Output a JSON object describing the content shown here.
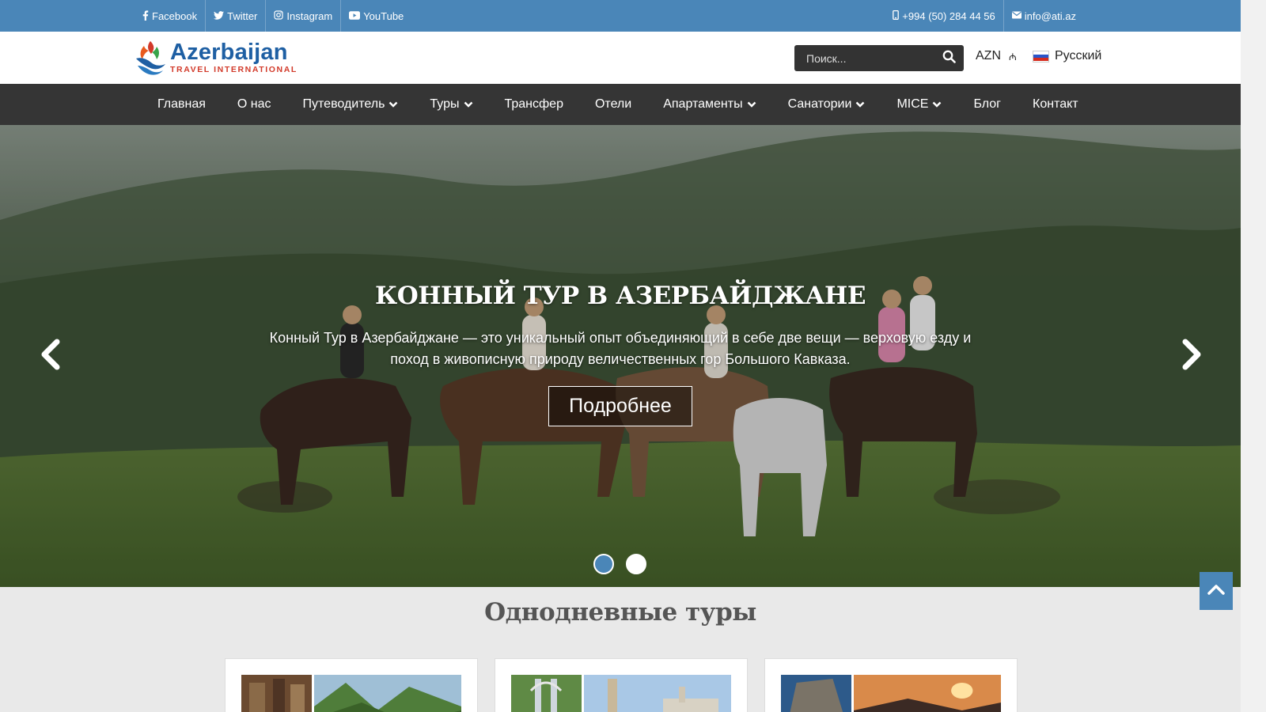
{
  "topbar": {
    "social": [
      {
        "label": "Facebook",
        "icon": "facebook-icon"
      },
      {
        "label": "Twitter",
        "icon": "twitter-icon"
      },
      {
        "label": "Instagram",
        "icon": "instagram-icon"
      },
      {
        "label": "YouTube",
        "icon": "youtube-icon"
      }
    ],
    "phone": "+994 (50) 284 44 56",
    "email": "info@ati.az"
  },
  "header": {
    "logo_title": "Azerbaijan",
    "logo_subtitle": "TRAVEL INTERNATIONAL",
    "search_placeholder": "Поиск...",
    "currency": "AZN",
    "currency_symbol": "₼",
    "language": "Русский"
  },
  "nav": {
    "items": [
      {
        "label": "Главная",
        "dropdown": false
      },
      {
        "label": "О нас",
        "dropdown": false
      },
      {
        "label": "Путеводитель",
        "dropdown": true
      },
      {
        "label": "Туры",
        "dropdown": true
      },
      {
        "label": "Трансфер",
        "dropdown": false
      },
      {
        "label": "Отели",
        "dropdown": false
      },
      {
        "label": "Апартаменты",
        "dropdown": true
      },
      {
        "label": "Санатории",
        "dropdown": true
      },
      {
        "label": "MICE",
        "dropdown": true
      },
      {
        "label": "Блог",
        "dropdown": false
      },
      {
        "label": "Контакт",
        "dropdown": false
      }
    ]
  },
  "hero": {
    "title": "КОННЫЙ ТУР В АЗЕРБАЙДЖАНЕ",
    "description": "Конный Тур в Азербайджане — это уникальный опыт объединяющий в себе две вещи — верховую езду и поход в живописную природу величественных гор Большого Кавказа.",
    "button_label": "Подробнее",
    "slide_count": 2,
    "active_slide": 1
  },
  "section": {
    "title": "Однодневные туры"
  },
  "colors": {
    "topbar": "#4a86b8",
    "nav": "#353535",
    "accent": "#4a86b8"
  }
}
